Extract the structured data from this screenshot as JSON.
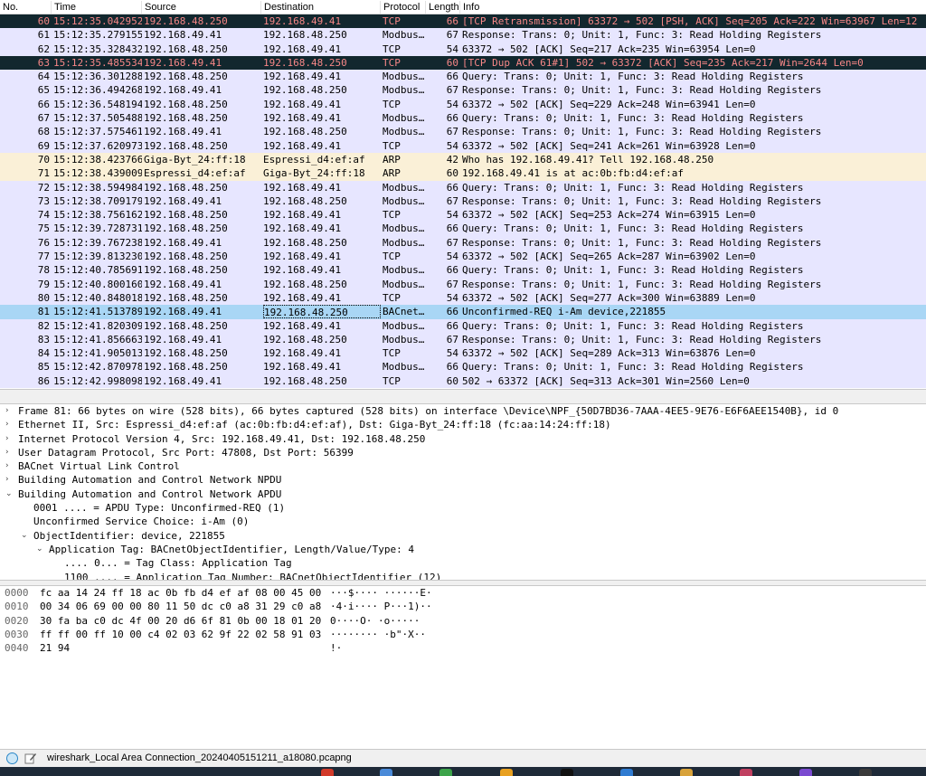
{
  "columns": {
    "no": "No.",
    "time": "Time",
    "source": "Source",
    "destination": "Destination",
    "protocol": "Protocol",
    "length": "Length",
    "info": "Info"
  },
  "packets": [
    {
      "no": "60",
      "time": "15:12:35.042952",
      "src": "192.168.48.250",
      "dst": "192.168.49.41",
      "proto": "TCP",
      "len": "66",
      "info": "[TCP Retransmission] 63372 → 502 [PSH, ACK] Seq=205 Ack=222 Win=63967 Len=12",
      "style": "bad"
    },
    {
      "no": "61",
      "time": "15:12:35.279155",
      "src": "192.168.49.41",
      "dst": "192.168.48.250",
      "proto": "Modbus…",
      "len": "67",
      "info": "Response: Trans:     0; Unit:   1, Func:   3: Read Holding Registers",
      "style": "modbus"
    },
    {
      "no": "62",
      "time": "15:12:35.328432",
      "src": "192.168.48.250",
      "dst": "192.168.49.41",
      "proto": "TCP",
      "len": "54",
      "info": "63372 → 502 [ACK] Seq=217 Ack=235 Win=63954 Len=0",
      "style": "tcp"
    },
    {
      "no": "63",
      "time": "15:12:35.485534",
      "src": "192.168.49.41",
      "dst": "192.168.48.250",
      "proto": "TCP",
      "len": "60",
      "info": "[TCP Dup ACK 61#1] 502 → 63372 [ACK] Seq=235 Ack=217 Win=2644 Len=0",
      "style": "bad"
    },
    {
      "no": "64",
      "time": "15:12:36.301288",
      "src": "192.168.48.250",
      "dst": "192.168.49.41",
      "proto": "Modbus…",
      "len": "66",
      "info": "   Query: Trans:     0; Unit:   1, Func:   3: Read Holding Registers",
      "style": "modbus"
    },
    {
      "no": "65",
      "time": "15:12:36.494268",
      "src": "192.168.49.41",
      "dst": "192.168.48.250",
      "proto": "Modbus…",
      "len": "67",
      "info": "Response: Trans:     0; Unit:   1, Func:   3: Read Holding Registers",
      "style": "modbus"
    },
    {
      "no": "66",
      "time": "15:12:36.548194",
      "src": "192.168.48.250",
      "dst": "192.168.49.41",
      "proto": "TCP",
      "len": "54",
      "info": "63372 → 502 [ACK] Seq=229 Ack=248 Win=63941 Len=0",
      "style": "tcp"
    },
    {
      "no": "67",
      "time": "15:12:37.505488",
      "src": "192.168.48.250",
      "dst": "192.168.49.41",
      "proto": "Modbus…",
      "len": "66",
      "info": "   Query: Trans:     0; Unit:   1, Func:   3: Read Holding Registers",
      "style": "modbus"
    },
    {
      "no": "68",
      "time": "15:12:37.575461",
      "src": "192.168.49.41",
      "dst": "192.168.48.250",
      "proto": "Modbus…",
      "len": "67",
      "info": "Response: Trans:     0; Unit:   1, Func:   3: Read Holding Registers",
      "style": "modbus"
    },
    {
      "no": "69",
      "time": "15:12:37.620973",
      "src": "192.168.48.250",
      "dst": "192.168.49.41",
      "proto": "TCP",
      "len": "54",
      "info": "63372 → 502 [ACK] Seq=241 Ack=261 Win=63928 Len=0",
      "style": "tcp"
    },
    {
      "no": "70",
      "time": "15:12:38.423766",
      "src": "Giga-Byt_24:ff:18",
      "dst": "Espressi_d4:ef:af",
      "proto": "ARP",
      "len": "42",
      "info": "Who has 192.168.49.41? Tell 192.168.48.250",
      "style": "arp"
    },
    {
      "no": "71",
      "time": "15:12:38.439009",
      "src": "Espressi_d4:ef:af",
      "dst": "Giga-Byt_24:ff:18",
      "proto": "ARP",
      "len": "60",
      "info": "192.168.49.41 is at ac:0b:fb:d4:ef:af",
      "style": "arp"
    },
    {
      "no": "72",
      "time": "15:12:38.594984",
      "src": "192.168.48.250",
      "dst": "192.168.49.41",
      "proto": "Modbus…",
      "len": "66",
      "info": "   Query: Trans:     0; Unit:   1, Func:   3: Read Holding Registers",
      "style": "modbus"
    },
    {
      "no": "73",
      "time": "15:12:38.709179",
      "src": "192.168.49.41",
      "dst": "192.168.48.250",
      "proto": "Modbus…",
      "len": "67",
      "info": "Response: Trans:     0; Unit:   1, Func:   3: Read Holding Registers",
      "style": "modbus"
    },
    {
      "no": "74",
      "time": "15:12:38.756162",
      "src": "192.168.48.250",
      "dst": "192.168.49.41",
      "proto": "TCP",
      "len": "54",
      "info": "63372 → 502 [ACK] Seq=253 Ack=274 Win=63915 Len=0",
      "style": "tcp"
    },
    {
      "no": "75",
      "time": "15:12:39.728731",
      "src": "192.168.48.250",
      "dst": "192.168.49.41",
      "proto": "Modbus…",
      "len": "66",
      "info": "   Query: Trans:     0; Unit:   1, Func:   3: Read Holding Registers",
      "style": "modbus"
    },
    {
      "no": "76",
      "time": "15:12:39.767238",
      "src": "192.168.49.41",
      "dst": "192.168.48.250",
      "proto": "Modbus…",
      "len": "67",
      "info": "Response: Trans:     0; Unit:   1, Func:   3: Read Holding Registers",
      "style": "modbus"
    },
    {
      "no": "77",
      "time": "15:12:39.813230",
      "src": "192.168.48.250",
      "dst": "192.168.49.41",
      "proto": "TCP",
      "len": "54",
      "info": "63372 → 502 [ACK] Seq=265 Ack=287 Win=63902 Len=0",
      "style": "tcp"
    },
    {
      "no": "78",
      "time": "15:12:40.785691",
      "src": "192.168.48.250",
      "dst": "192.168.49.41",
      "proto": "Modbus…",
      "len": "66",
      "info": "   Query: Trans:     0; Unit:   1, Func:   3: Read Holding Registers",
      "style": "modbus"
    },
    {
      "no": "79",
      "time": "15:12:40.800160",
      "src": "192.168.49.41",
      "dst": "192.168.48.250",
      "proto": "Modbus…",
      "len": "67",
      "info": "Response: Trans:     0; Unit:   1, Func:   3: Read Holding Registers",
      "style": "modbus"
    },
    {
      "no": "80",
      "time": "15:12:40.848018",
      "src": "192.168.48.250",
      "dst": "192.168.49.41",
      "proto": "TCP",
      "len": "54",
      "info": "63372 → 502 [ACK] Seq=277 Ack=300 Win=63889 Len=0",
      "style": "tcp"
    },
    {
      "no": "81",
      "time": "15:12:41.513789",
      "src": "192.168.49.41",
      "dst": "192.168.48.250",
      "proto": "BACnet…",
      "len": "66",
      "info": "Unconfirmed-REQ i-Am device,221855",
      "style": "selected"
    },
    {
      "no": "82",
      "time": "15:12:41.820309",
      "src": "192.168.48.250",
      "dst": "192.168.49.41",
      "proto": "Modbus…",
      "len": "66",
      "info": "   Query: Trans:     0; Unit:   1, Func:   3: Read Holding Registers",
      "style": "modbus"
    },
    {
      "no": "83",
      "time": "15:12:41.856663",
      "src": "192.168.49.41",
      "dst": "192.168.48.250",
      "proto": "Modbus…",
      "len": "67",
      "info": "Response: Trans:     0; Unit:   1, Func:   3: Read Holding Registers",
      "style": "modbus"
    },
    {
      "no": "84",
      "time": "15:12:41.905013",
      "src": "192.168.48.250",
      "dst": "192.168.49.41",
      "proto": "TCP",
      "len": "54",
      "info": "63372 → 502 [ACK] Seq=289 Ack=313 Win=63876 Len=0",
      "style": "tcp"
    },
    {
      "no": "85",
      "time": "15:12:42.870978",
      "src": "192.168.48.250",
      "dst": "192.168.49.41",
      "proto": "Modbus…",
      "len": "66",
      "info": "   Query: Trans:     0; Unit:   1, Func:   3: Read Holding Registers",
      "style": "modbus"
    },
    {
      "no": "86",
      "time": "15:12:42.998098",
      "src": "192.168.49.41",
      "dst": "192.168.48.250",
      "proto": "TCP",
      "len": "60",
      "info": "502 → 63372 [ACK] Seq=313 Ack=301 Win=2560 Len=0",
      "style": "tcp"
    }
  ],
  "details": [
    {
      "text": "Frame 81: 66 bytes on wire (528 bits), 66 bytes captured (528 bits) on interface \\Device\\NPF_{50D7BD36-7AAA-4EE5-9E76-E6F6AEE1540B}, id 0",
      "indent": 0,
      "arrow": "›"
    },
    {
      "text": "Ethernet II, Src: Espressi_d4:ef:af (ac:0b:fb:d4:ef:af), Dst: Giga-Byt_24:ff:18 (fc:aa:14:24:ff:18)",
      "indent": 0,
      "arrow": "›"
    },
    {
      "text": "Internet Protocol Version 4, Src: 192.168.49.41, Dst: 192.168.48.250",
      "indent": 0,
      "arrow": "›"
    },
    {
      "text": "User Datagram Protocol, Src Port: 47808, Dst Port: 56399",
      "indent": 0,
      "arrow": "›"
    },
    {
      "text": "BACnet Virtual Link Control",
      "indent": 0,
      "arrow": "›"
    },
    {
      "text": "Building Automation and Control Network NPDU",
      "indent": 0,
      "arrow": "›"
    },
    {
      "text": "Building Automation and Control Network APDU",
      "indent": 0,
      "arrow": "⌄"
    },
    {
      "text": "0001 .... = APDU Type: Unconfirmed-REQ (1)",
      "indent": 1,
      "arrow": ""
    },
    {
      "text": "Unconfirmed Service Choice: i-Am (0)",
      "indent": 1,
      "arrow": ""
    },
    {
      "text": "ObjectIdentifier: device, 221855",
      "indent": 1,
      "arrow": "⌄"
    },
    {
      "text": "Application Tag: BACnetObjectIdentifier, Length/Value/Type: 4",
      "indent": 2,
      "arrow": "⌄"
    },
    {
      "text": ".... 0... = Tag Class: Application Tag",
      "indent": 3,
      "arrow": ""
    },
    {
      "text": "1100 .... = Application Tag Number: BACnetObjectIdentifier (12)",
      "indent": 3,
      "arrow": ""
    }
  ],
  "bytes": [
    {
      "off": "0000",
      "hex": "fc aa 14 24 ff 18 ac 0b  fb d4 ef af 08 00 45 00",
      "ascii": "···$···· ······E·"
    },
    {
      "off": "0010",
      "hex": "00 34 06 69 00 00 80 11  50 dc c0 a8 31 29 c0 a8",
      "ascii": "·4·i···· P···1)··"
    },
    {
      "off": "0020",
      "hex": "30 fa ba c0 dc 4f 00 20  d6 6f 81 0b 00 18 01 20",
      "ascii": "0····O·  ·o····· "
    },
    {
      "off": "0030",
      "hex": "ff ff 00 ff 10 00 c4 02  03 62 9f 22 02 58 91 03",
      "ascii": "········ ·b\"·X··"
    },
    {
      "off": "0040",
      "hex": "21 94",
      "ascii": "!·"
    }
  ],
  "status": {
    "file": "wireshark_Local Area Connection_20240405151211_a18080.pcapng"
  },
  "colors": {
    "tcp_modbus_row": "#e7e6ff",
    "arp_row": "#faf0d7",
    "bad_row_bg": "#12272e",
    "bad_row_fg": "#f78787",
    "selected_row": "#a9d6f5"
  }
}
